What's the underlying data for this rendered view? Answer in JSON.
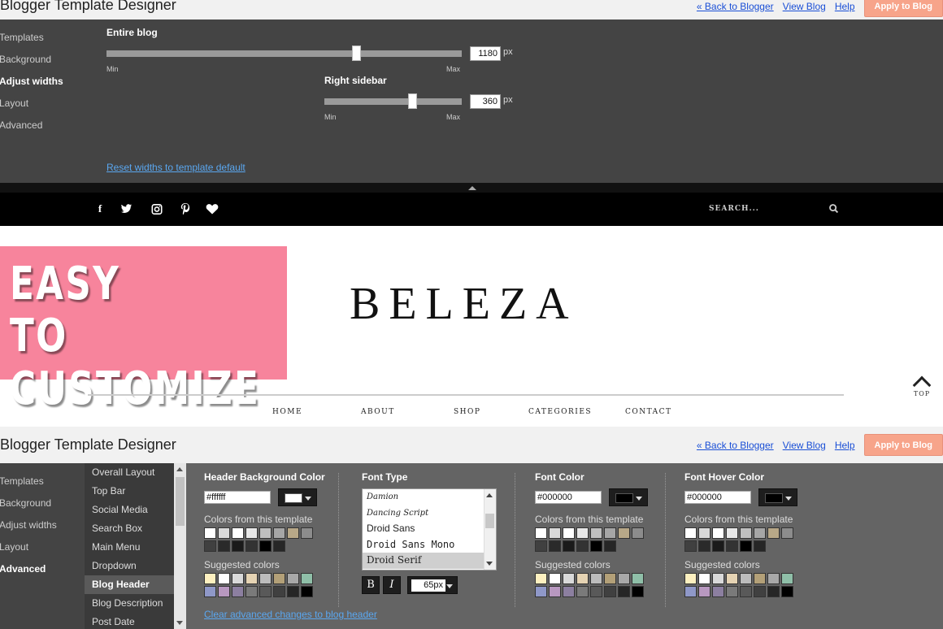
{
  "designer": {
    "title": "Blogger Template Designer",
    "links": {
      "back": "« Back to Blogger",
      "view": "View Blog",
      "help": "Help"
    },
    "apply_label": "Apply to Blog"
  },
  "top_panel": {
    "nav": [
      "Templates",
      "Background",
      "Adjust widths",
      "Layout",
      "Advanced"
    ],
    "active_nav": "Adjust widths",
    "entire_blog": {
      "label": "Entire blog",
      "value": "1180",
      "unit": "px",
      "min": "Min",
      "max": "Max",
      "level": 0.71
    },
    "right_sidebar": {
      "label": "Right sidebar",
      "value": "360",
      "unit": "px",
      "min": "Min",
      "max": "Max",
      "level": 0.65
    },
    "reset_link": "Reset widths to template default"
  },
  "blog": {
    "search_placeholder": "SEARCH...",
    "social_icons": [
      "facebook-icon",
      "twitter-icon",
      "instagram-icon",
      "pinterest-icon",
      "heart-icon"
    ],
    "promo": {
      "line1": "EASY",
      "line2": "TO CUSTOMIZE",
      "color": "#f7849c"
    },
    "title": "BELEZA",
    "top_label": "TOP",
    "menu": [
      "HOME",
      "ABOUT",
      "SHOP",
      "CATEGORIES",
      "CONTACT"
    ]
  },
  "bottom_panel": {
    "nav": [
      "Templates",
      "Background",
      "Adjust widths",
      "Layout",
      "Advanced"
    ],
    "active_nav": "Advanced",
    "sub_nav": [
      "Overall Layout",
      "Top Bar",
      "Social Media",
      "Search Box",
      "Main Menu",
      "Dropdown",
      "Blog Header",
      "Blog Description",
      "Post Date"
    ],
    "active_sub": "Blog Header",
    "header_bg": {
      "title": "Header Background Color",
      "hex": "#ffffff",
      "swatch": "#ffffff"
    },
    "font_type": {
      "title": "Font Type",
      "options": [
        "Damion",
        "Dancing Script",
        "Droid Sans",
        "Droid Sans Mono",
        "Droid Serif"
      ],
      "selected": "Droid Serif",
      "bold_label": "B",
      "italic_label": "I",
      "size": "65px"
    },
    "font_color": {
      "title": "Font Color",
      "hex": "#000000",
      "swatch": "#000000"
    },
    "font_hover": {
      "title": "Font Hover Color",
      "hex": "#000000",
      "swatch": "#000000"
    },
    "template_colors_label": "Colors from this template",
    "suggested_label": "Suggested colors",
    "template_colors": [
      [
        "#ffffff",
        "#d9d9d9",
        "#ffffff",
        "#e8e8e8",
        "#bfbfbf",
        "#a6a6a6",
        "#b8a888",
        "#8c8c8c"
      ],
      [
        "#404040",
        "#2a2a2a",
        "#1a1a1a",
        "#333333",
        "#000000",
        "#262626"
      ]
    ],
    "suggested_colors": [
      [
        "#fdf0c0",
        "#ffffff",
        "#d9d9d9",
        "#e5d3b3",
        "#bcbcbc",
        "#b3a078",
        "#a8a8a8",
        "#8fbfa8"
      ],
      [
        "#8f98c8",
        "#b898c0",
        "#8c7fa0",
        "#7a7a7a",
        "#595959",
        "#404040",
        "#262626",
        "#000000"
      ]
    ],
    "clear_link": "Clear advanced changes to blog header"
  }
}
